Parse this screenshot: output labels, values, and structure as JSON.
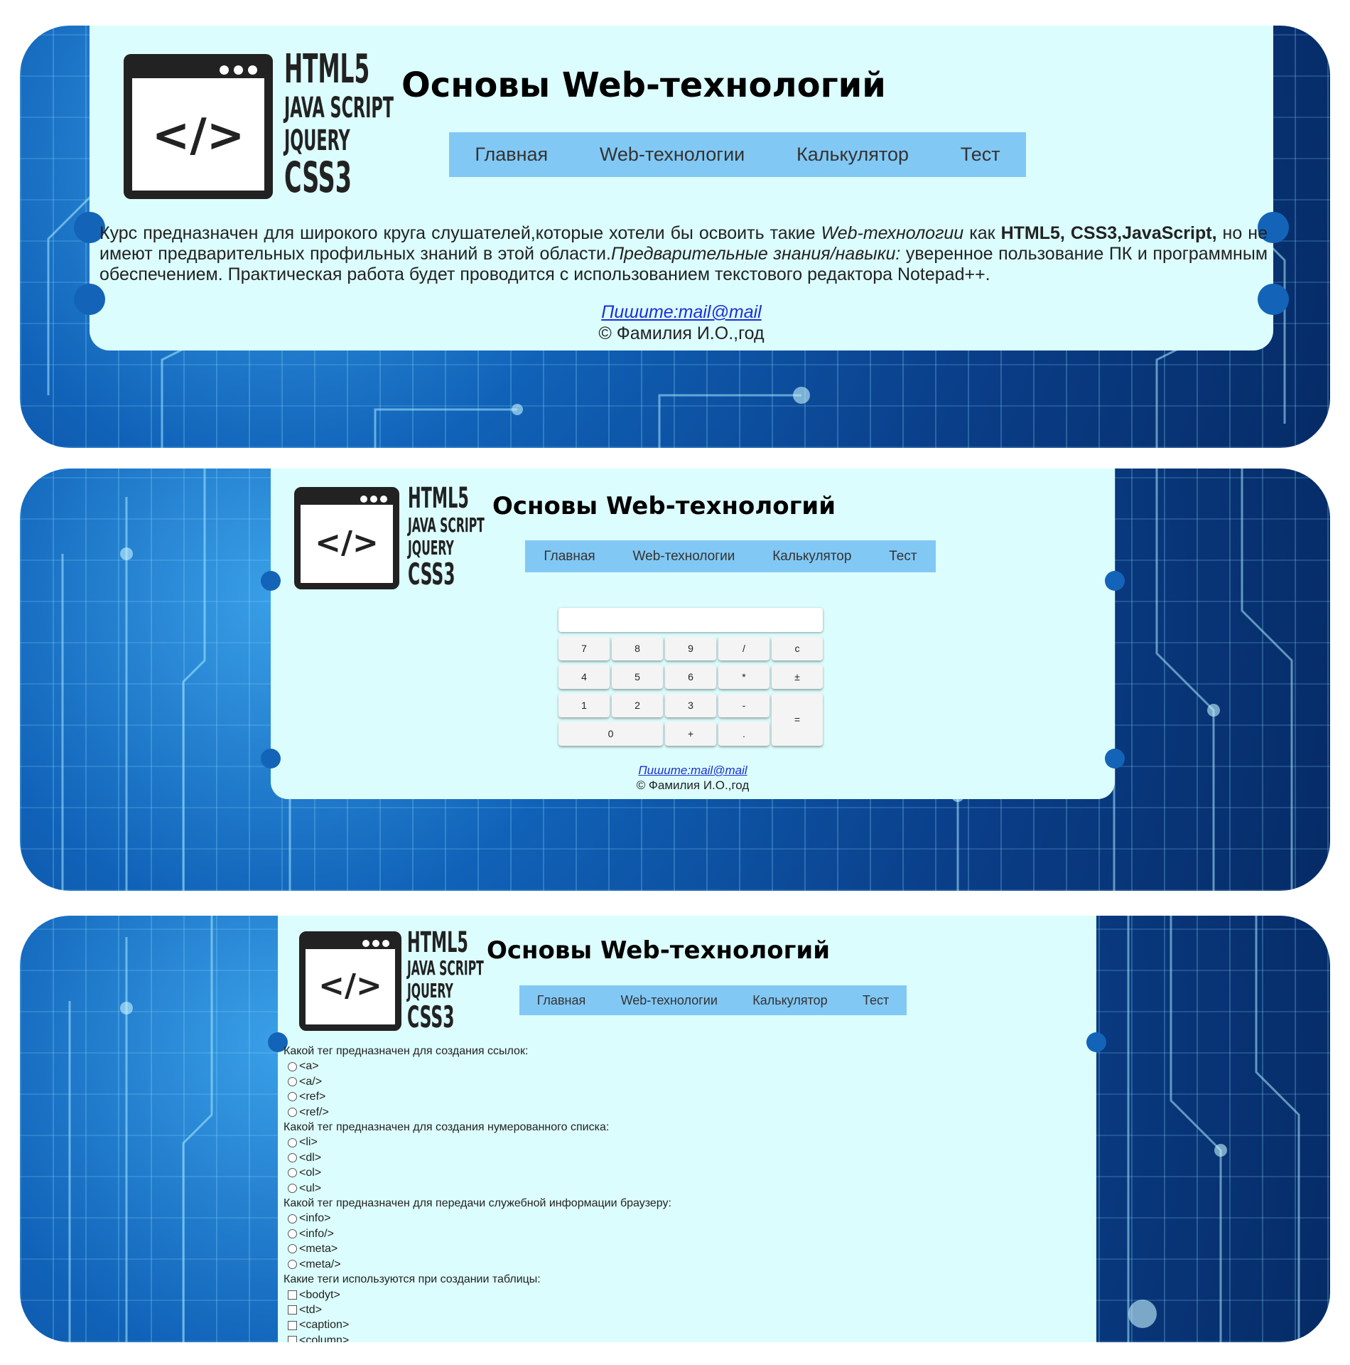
{
  "site": {
    "title": "Основы Web-технологий",
    "logo_lines": [
      "HTML5",
      "JAVA SCRIPT",
      "JQUERY",
      "CSS3"
    ],
    "logo_code": "</>"
  },
  "nav": {
    "items": [
      "Главная",
      "Web-технологии",
      "Калькулятор",
      "Тест"
    ]
  },
  "home": {
    "intro_1": "Курс предназначен для широкого круга слушателей,которые хотели бы освоить такие ",
    "intro_em1": "Web-технологии",
    "intro_2": " как ",
    "intro_strong": "HTML5, CSS3,JavaScript,",
    "intro_3": " но не имеют предварительных профильных знаний в этой области.",
    "intro_em2": "Предварительные знания/навыки:",
    "intro_4": " уверенное пользование ПК и программным обеспечением. Практическая работа будет проводится с использованием текстового редактора Notepad++."
  },
  "footer": {
    "link": "Пишите:mail@mail",
    "copyright": "© Фамилия И.О.,год"
  },
  "calculator": {
    "display_value": "",
    "keys": [
      "7",
      "8",
      "9",
      "/",
      "c",
      "4",
      "5",
      "6",
      "*",
      "±",
      "1",
      "2",
      "3",
      "-",
      "=",
      "0",
      "+",
      "."
    ]
  },
  "quiz": {
    "questions": [
      {
        "text": "Какой тег предназначен для создания ссылок:",
        "type": "radio",
        "options": [
          "<a>",
          "<a/>",
          "<ref>",
          "<ref/>"
        ]
      },
      {
        "text": "Какой тег предназначен для создания нумерованного списка:",
        "type": "radio",
        "options": [
          "<li>",
          "<dl>",
          "<ol>",
          "<ul>"
        ]
      },
      {
        "text": "Какой тег предназначен для передачи служебной информации браузеру:",
        "type": "radio",
        "options": [
          "<info>",
          "<info/>",
          "<meta>",
          "<meta/>"
        ]
      },
      {
        "text": "Какие теги используются при создании таблицы:",
        "type": "checkbox",
        "options": [
          "<bodyt>",
          "<td>",
          "<caption>",
          "<column>"
        ]
      }
    ]
  },
  "colors": {
    "panel": "#dcfdfd",
    "nav": "#82c8f4",
    "link": "#1a2fd8"
  }
}
